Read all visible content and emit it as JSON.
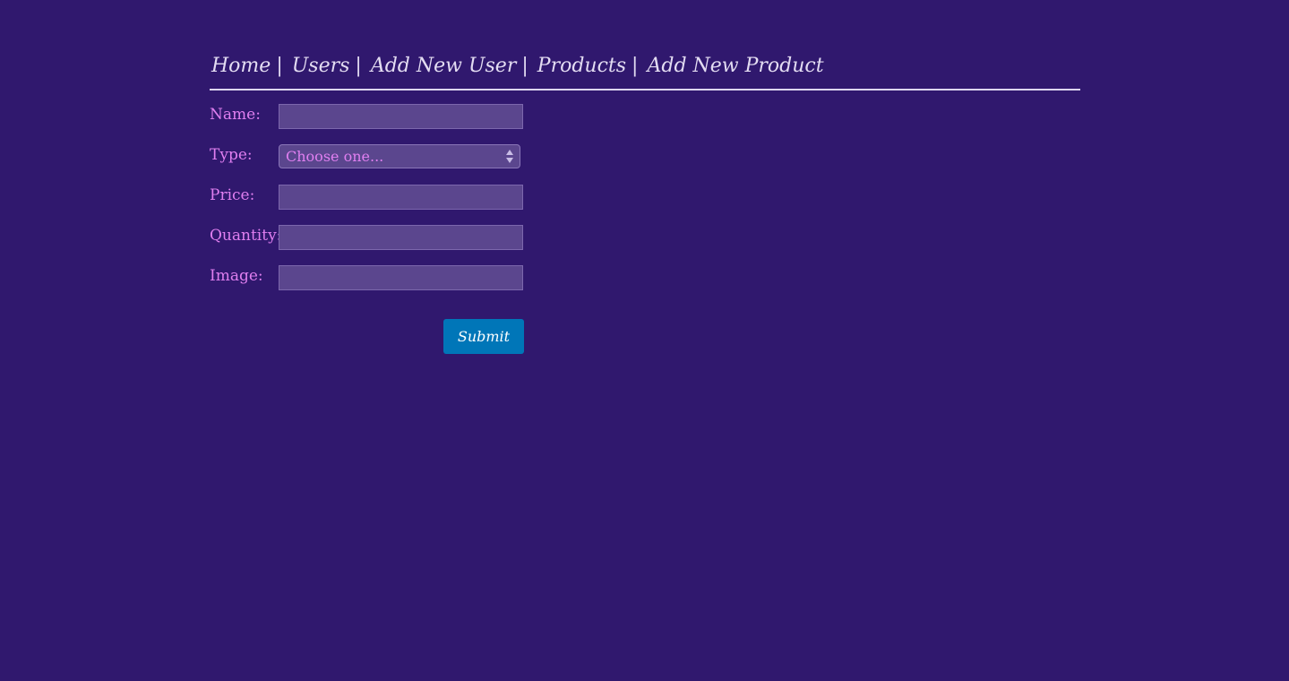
{
  "nav": {
    "items": [
      {
        "label": "Home"
      },
      {
        "label": "Users"
      },
      {
        "label": "Add New User"
      },
      {
        "label": "Products"
      },
      {
        "label": "Add New Product"
      }
    ],
    "separator": "|"
  },
  "form": {
    "fields": {
      "name": {
        "label": "Name:",
        "value": ""
      },
      "type": {
        "label": "Type:",
        "selected": "Choose one..."
      },
      "price": {
        "label": "Price:",
        "value": ""
      },
      "quantity": {
        "label": "Quantity:",
        "value": ""
      },
      "image": {
        "label": "Image:",
        "value": ""
      }
    },
    "submit_label": "Submit"
  },
  "colors": {
    "background": "#30186e",
    "label": "#e07ff0",
    "nav_text": "#e3dcf2",
    "input_bg": "#5b468e",
    "button_bg": "#0076b8"
  }
}
